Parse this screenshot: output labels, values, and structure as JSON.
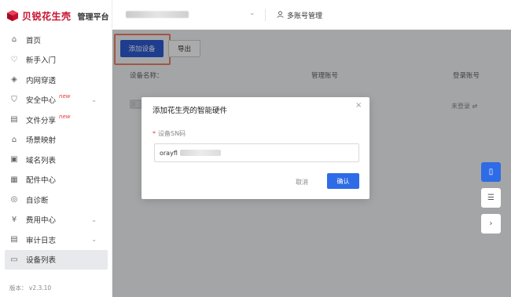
{
  "brand": {
    "name": "贝锐花生壳",
    "subtitle": "管理平台",
    "color": "#c8102e"
  },
  "header": {
    "account_chevron": "⌄",
    "multi_account": "多账号管理"
  },
  "sidebar": {
    "items": [
      {
        "label": "首页",
        "icon": "home-icon",
        "glyph": "⌂"
      },
      {
        "label": "新手入门",
        "icon": "bulb-icon",
        "glyph": "♡"
      },
      {
        "label": "内网穿透",
        "icon": "cube-icon",
        "glyph": "◈"
      },
      {
        "label": "安全中心",
        "icon": "shield-icon",
        "glyph": "⛉",
        "badge": "new",
        "chevron": "⌄"
      },
      {
        "label": "文件分享",
        "icon": "folder-icon",
        "glyph": "▤",
        "badge": "new"
      },
      {
        "label": "场景映射",
        "icon": "scene-icon",
        "glyph": "⌂"
      },
      {
        "label": "域名列表",
        "icon": "domain-icon",
        "glyph": "▣"
      },
      {
        "label": "配件中心",
        "icon": "grid-icon",
        "glyph": "▦"
      },
      {
        "label": "自诊断",
        "icon": "diagnose-icon",
        "glyph": "◎"
      },
      {
        "label": "费用中心",
        "icon": "fee-icon",
        "glyph": "¥",
        "chevron": "⌄"
      },
      {
        "label": "审计日志",
        "icon": "log-icon",
        "glyph": "▤",
        "chevron": "⌄"
      },
      {
        "label": "设备列表",
        "icon": "device-icon",
        "glyph": "▭",
        "active": true
      }
    ],
    "version_label": "版本：",
    "version_value": "v2.3.10"
  },
  "toolbar": {
    "add_label": "添加设备",
    "export_label": "导出"
  },
  "table": {
    "columns": [
      "设备名称：",
      "管理账号",
      "登录账号"
    ],
    "row": {
      "status": "未登录 ⇄"
    }
  },
  "modal": {
    "title": "添加花生壳的智能硬件",
    "close": "×",
    "field_label": "设备SN码",
    "required_mark": "*",
    "field_value": "orayfl",
    "cancel_label": "取消",
    "confirm_label": "确认"
  },
  "float": {
    "phone": "▯",
    "list": "☰",
    "next": "›"
  },
  "colors": {
    "primary": "#2e5bd6",
    "highlight": "#f08068",
    "badge": "#e53935"
  }
}
